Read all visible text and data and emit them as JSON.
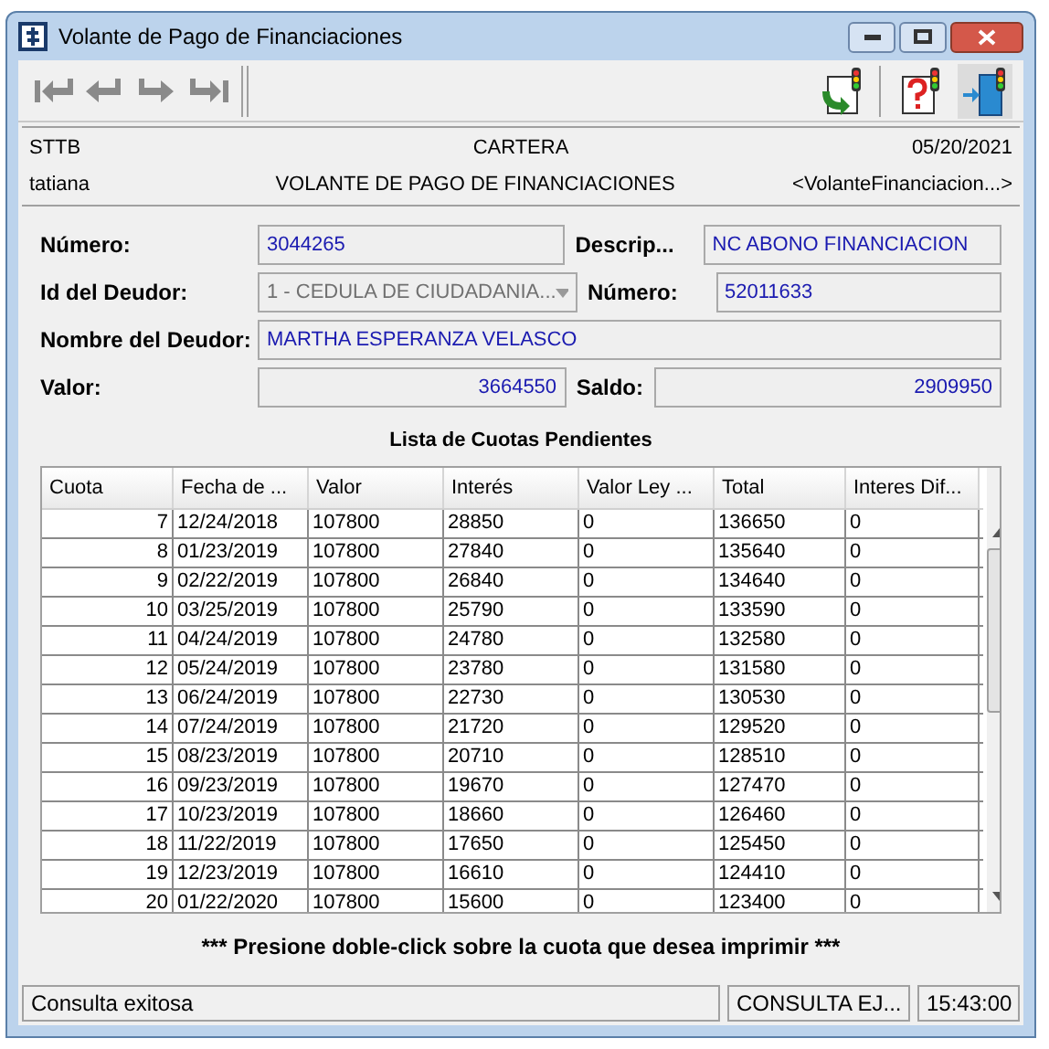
{
  "window": {
    "title": "Volante de Pago de Financiaciones"
  },
  "toolbar": {
    "nav": [
      {
        "kind": "first",
        "disabled": true
      },
      {
        "kind": "prev",
        "disabled": true
      },
      {
        "kind": "next",
        "disabled": true
      },
      {
        "kind": "last",
        "disabled": true
      }
    ],
    "actions": [
      {
        "kind": "refresh"
      },
      {
        "kind": "help"
      },
      {
        "kind": "exit"
      }
    ]
  },
  "header": {
    "company": "STTB",
    "module": "CARTERA",
    "date": "05/20/2021",
    "user": "tatiana",
    "screen": "VOLANTE DE PAGO DE FINANCIACIONES",
    "program": "<VolanteFinanciacion...>"
  },
  "form": {
    "numero": {
      "label": "Número:",
      "value": "3044265"
    },
    "descripcion": {
      "label": "Descrip...",
      "value": "NC ABONO FINANCIACION"
    },
    "id_deudor": {
      "label": "Id del Deudor:",
      "value": "1 - CEDULA DE CIUDADANIA...",
      "disabled": true
    },
    "numero_deudor": {
      "label": "Número:",
      "value": "52011633"
    },
    "nombre_deudor": {
      "label": "Nombre del Deudor:",
      "value": "MARTHA ESPERANZA VELASCO"
    },
    "valor": {
      "label": "Valor:",
      "value": "3664550"
    },
    "saldo": {
      "label": "Saldo:",
      "value": "2909950"
    }
  },
  "table": {
    "title": "Lista de Cuotas Pendientes",
    "columns": [
      "Cuota",
      "Fecha de ...",
      "Valor",
      "Interés",
      "Valor Ley ...",
      "Total",
      "Interes Dif..."
    ],
    "rows": [
      [
        "7",
        "12/24/2018",
        "107800",
        "28850",
        "0",
        "136650",
        "0"
      ],
      [
        "8",
        "01/23/2019",
        "107800",
        "27840",
        "0",
        "135640",
        "0"
      ],
      [
        "9",
        "02/22/2019",
        "107800",
        "26840",
        "0",
        "134640",
        "0"
      ],
      [
        "10",
        "03/25/2019",
        "107800",
        "25790",
        "0",
        "133590",
        "0"
      ],
      [
        "11",
        "04/24/2019",
        "107800",
        "24780",
        "0",
        "132580",
        "0"
      ],
      [
        "12",
        "05/24/2019",
        "107800",
        "23780",
        "0",
        "131580",
        "0"
      ],
      [
        "13",
        "06/24/2019",
        "107800",
        "22730",
        "0",
        "130530",
        "0"
      ],
      [
        "14",
        "07/24/2019",
        "107800",
        "21720",
        "0",
        "129520",
        "0"
      ],
      [
        "15",
        "08/23/2019",
        "107800",
        "20710",
        "0",
        "128510",
        "0"
      ],
      [
        "16",
        "09/23/2019",
        "107800",
        "19670",
        "0",
        "127470",
        "0"
      ],
      [
        "17",
        "10/23/2019",
        "107800",
        "18660",
        "0",
        "126460",
        "0"
      ],
      [
        "18",
        "11/22/2019",
        "107800",
        "17650",
        "0",
        "125450",
        "0"
      ],
      [
        "19",
        "12/23/2019",
        "107800",
        "16610",
        "0",
        "124410",
        "0"
      ],
      [
        "20",
        "01/22/2020",
        "107800",
        "15600",
        "0",
        "123400",
        "0"
      ]
    ]
  },
  "hint": "*** Presione doble-click sobre la cuota que desea imprimir ***",
  "status_bar": {
    "message": "Consulta exitosa",
    "mode": "CONSULTA EJ...",
    "time": "15:43:00"
  }
}
